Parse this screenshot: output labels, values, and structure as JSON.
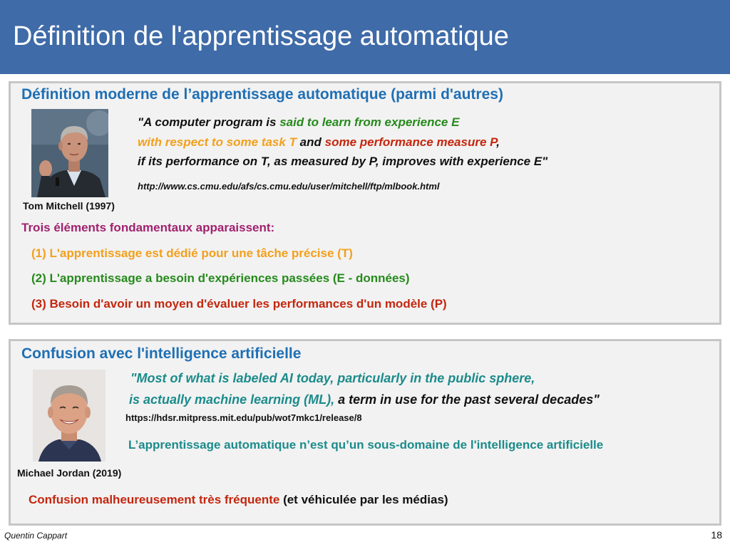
{
  "header": {
    "title": "Définition de l'apprentissage automatique"
  },
  "block1": {
    "title": "Définition moderne de l’apprentissage automatique (parmi d'autres)",
    "caption": "Tom Mitchell (1997)",
    "quote": {
      "line1": [
        "\"A computer program is ",
        "said to learn from experience E"
      ],
      "line2": [
        "with respect to some task T",
        " and ",
        "some performance measure P",
        ","
      ],
      "line3": [
        "if its performance on T, as measured by P, improves with experience E\""
      ]
    },
    "url": "http://www.cs.cmu.edu/afs/cs.cmu.edu/user/mitchell/ftp/mlbook.html",
    "intro": "Trois éléments fondamentaux apparaissent:",
    "items": [
      "(1) L'apprentissage est dédié pour une tâche précise (T)",
      "(2) L'apprentissage a besoin d'expériences passées (E - données)",
      "(3) Besoin d'avoir un moyen d'évaluer les performances d'un modèle (P)"
    ]
  },
  "block2": {
    "title": "Confusion avec l'intelligence artificielle",
    "caption": "Michael Jordan (2019)",
    "quote": {
      "line1": [
        "\"Most of what is labeled AI today, particularly in the public sphere,"
      ],
      "line2": [
        "is actually machine learning (ML),",
        " a term in use for the past several decades\""
      ]
    },
    "url": "https://hdsr.mitpress.mit.edu/pub/wot7mkc1/release/8",
    "statement": "L’apprentissage automatique n’est qu’un sous-domaine de l'intelligence artificielle",
    "conclusion": [
      "Confusion malheureusement très fréquente",
      " (et véhiculée par les médias)"
    ]
  },
  "footer": {
    "author": "Quentin Cappart",
    "page": "18"
  },
  "colors": {
    "header_bg": "#3f6ba8",
    "header_text": "#ffffff",
    "block_bg": "#f2f2f2",
    "block_border": "#c6c6c6",
    "block_title": "#1f6fb4",
    "text": "#111111",
    "green": "#268a1c",
    "orange": "#f2a01c",
    "red": "#c4260e",
    "purple": "#a1216f",
    "teal": "#1c8b8b"
  }
}
